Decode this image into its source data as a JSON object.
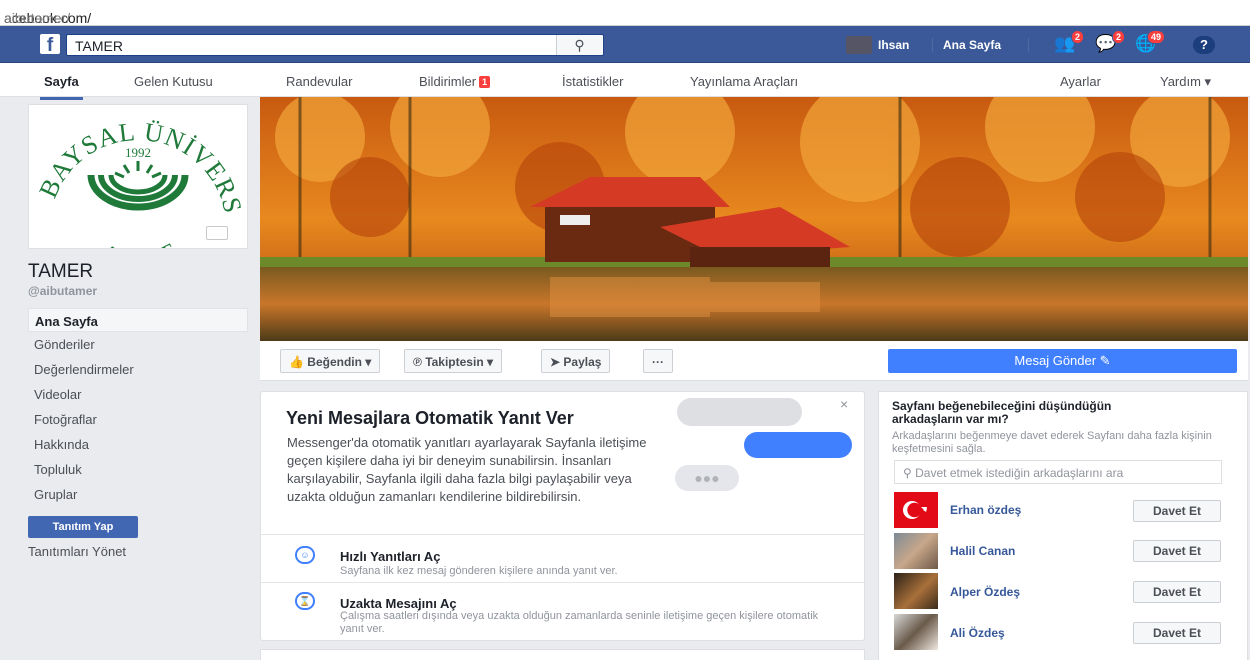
{
  "browser": {
    "url_prefix": "acebook.com/",
    "url_path": "aibutamer/"
  },
  "topbar": {
    "logo": "f",
    "search_value": "TAMER",
    "search_icon": "magnifier-icon",
    "profile_name": "Ihsan",
    "home_label": "Ana Sayfa",
    "friend_requests_count": "2",
    "messages_count": "2",
    "notifications_count": "49",
    "help_label": "?"
  },
  "page_nav": {
    "items": [
      "Sayfa",
      "Gelen Kutusu",
      "Randevular",
      "Bildirimler",
      "İstatistikler",
      "Yayınlama Araçları"
    ],
    "notifications_badge": "1",
    "settings_label": "Ayarlar",
    "help_label": "Yardım ▾"
  },
  "profile": {
    "logo_text_top": "İZZET BAYSAL ÜNİVERSİTESİ",
    "logo_text_bottom": "ABANT",
    "logo_year": "1992",
    "page_name": "TAMER",
    "username": "@aibutamer"
  },
  "sidebar": {
    "items": [
      "Ana Sayfa",
      "Gönderiler",
      "Değerlendirmeler",
      "Videolar",
      "Fotoğraflar",
      "Hakkında",
      "Topluluk",
      "Gruplar"
    ],
    "promote_label": "Tanıtım Yap",
    "manage_label": "Tanıtımları Yönet"
  },
  "actions": {
    "like": "Beğendin ▾",
    "follow": "Takiptesin ▾",
    "share": "Paylaş",
    "more": "···",
    "message": "Mesaj Gönder ✎"
  },
  "auto_reply": {
    "title": "Yeni Mesajlara Otomatik Yanıt Ver",
    "description": "Messenger'da otomatik yanıtları ayarlayarak Sayfanla iletişime geçen kişilere daha iyi bir deneyim sunabilirsin. İnsanları karşılayabilir, Sayfanla ilgili daha fazla bilgi paylaşabilir veya uzakta olduğun zamanları kendilerine bildirebilirsin.",
    "close": "×",
    "options": [
      {
        "title": "Hızlı Yanıtları Aç",
        "subtitle": "Sayfana ilk kez mesaj gönderen kişilere anında yanıt ver."
      },
      {
        "title": "Uzakta Mesajını Aç",
        "subtitle": "Çalışma saatleri dışında veya uzakta olduğun zamanlarda seninle iletişime geçen kişilere otomatik yanıt ver."
      }
    ]
  },
  "invite": {
    "title": "Sayfanı beğenebileceğini düşündüğün arkadaşların var mı?",
    "subtitle": "Arkadaşlarını beğenmeye davet ederek Sayfanı daha fazla kişinin keşfetmesini sağla.",
    "search_placeholder": "Davet etmek istediğin arkadaşlarını ara",
    "button_label": "Davet Et",
    "friends": [
      "Erhan özdeş",
      "Halil Canan",
      "Alper Özdeş",
      "Ali Özdeş"
    ]
  },
  "colors": {
    "brand": "#3b5998",
    "accent": "#4080ff",
    "badge": "#fa3e3e"
  }
}
